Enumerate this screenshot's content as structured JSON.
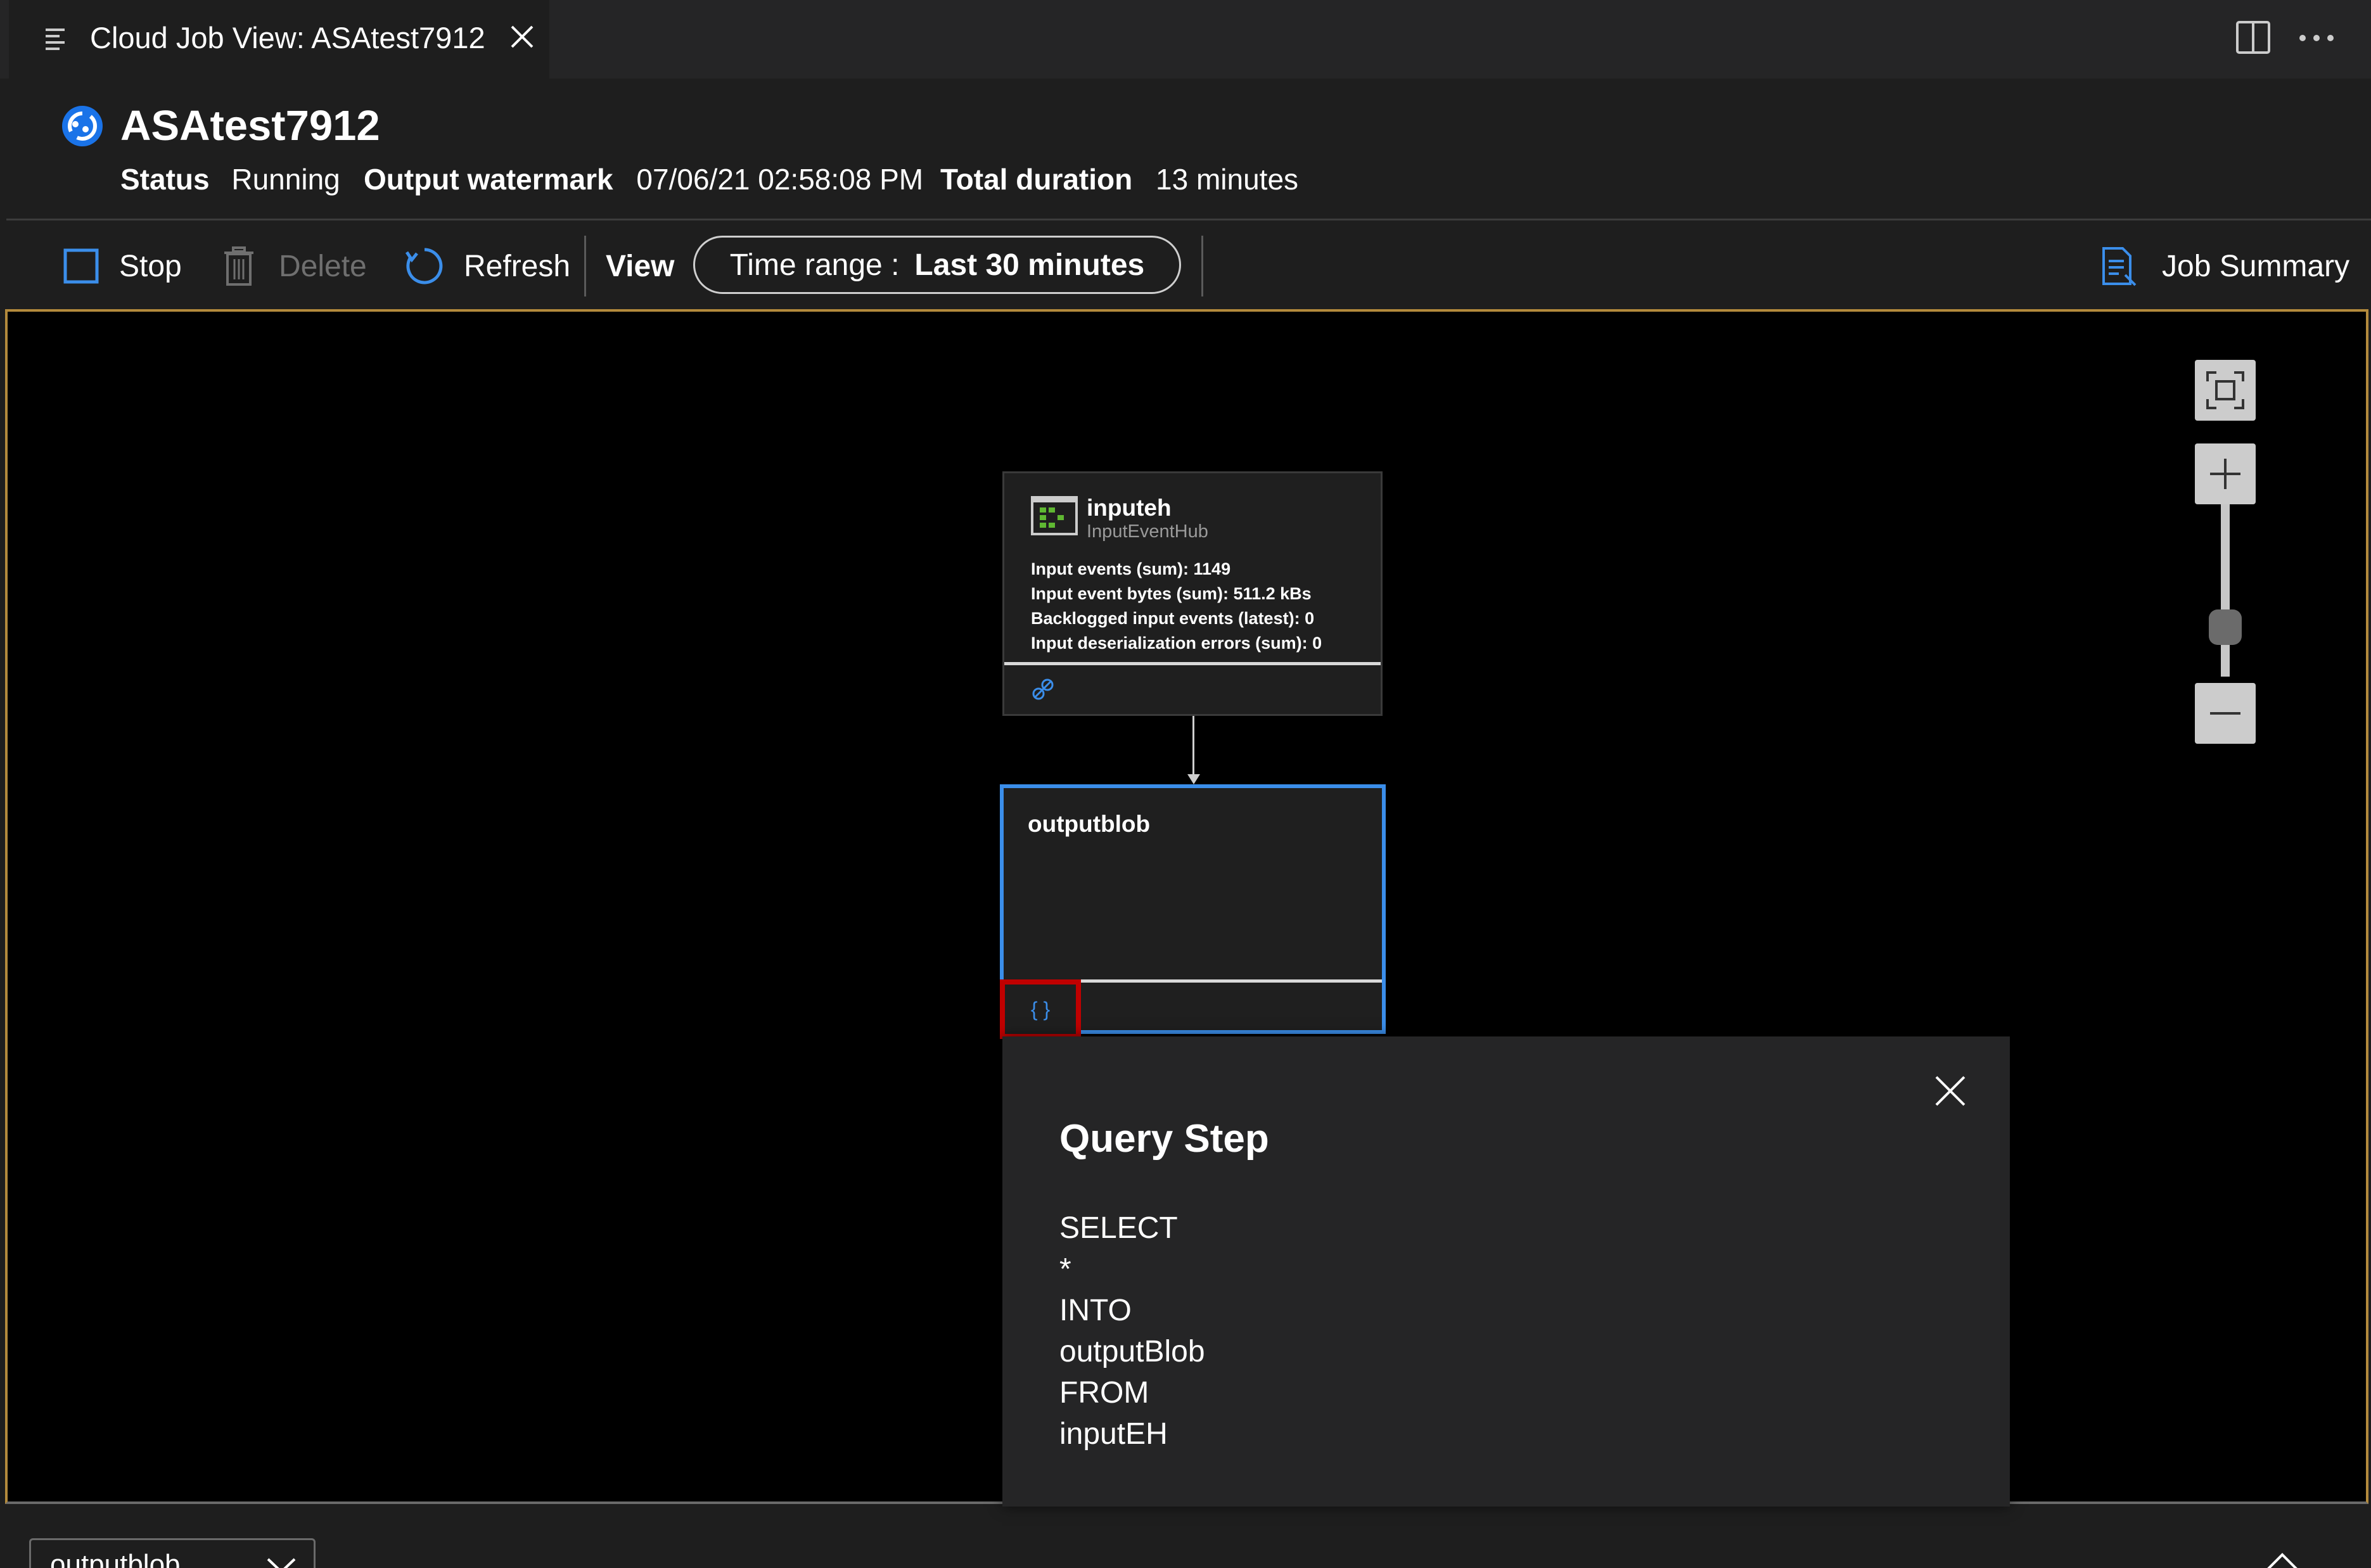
{
  "tab": {
    "title": "Cloud Job View: ASAtest7912"
  },
  "job": {
    "name": "ASAtest7912",
    "status_label": "Status",
    "status_value": "Running",
    "watermark_label": "Output watermark",
    "watermark_value": "07/06/21 02:58:08 PM",
    "duration_label": "Total duration",
    "duration_value": "13 minutes"
  },
  "toolbar": {
    "stop_label": "Stop",
    "delete_label": "Delete",
    "refresh_label": "Refresh",
    "view_label": "View",
    "time_range_label": "Time range :",
    "time_range_value": "Last 30 minutes",
    "job_summary_label": "Job Summary"
  },
  "diagram": {
    "input_node": {
      "name": "inputeh",
      "type": "InputEventHub",
      "metrics": [
        "Input events (sum): 1149",
        "Input event bytes (sum): 511.2 kBs",
        "Backlogged input events (latest): 0",
        "Input deserialization errors (sum): 0"
      ]
    },
    "output_node": {
      "name": "outputblob"
    },
    "query_button_glyph": "{ }"
  },
  "query_panel": {
    "title": "Query Step",
    "lines": [
      "SELECT",
      "*",
      "INTO",
      "outputBlob",
      "FROM",
      "inputEH"
    ]
  },
  "bottom": {
    "selected_node": "outputblob"
  },
  "colors": {
    "accent": "#3b8eea",
    "highlight": "#c00000",
    "canvas_border": "#b38a3c",
    "eventhub_green": "#5fb832"
  }
}
